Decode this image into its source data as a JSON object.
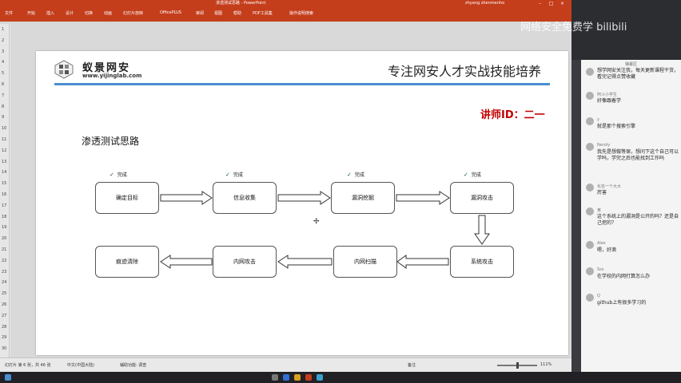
{
  "window": {
    "title": "渗透测试思路 - PowerPoint",
    "user": "zhyang zhenmenho"
  },
  "menu": [
    "文件",
    "开始",
    "插入",
    "设计",
    "切换",
    "动画",
    "幻灯片放映",
    "OfficePLUS",
    "审阅",
    "视图",
    "帮助",
    "PDF工具集",
    "操作说明搜索"
  ],
  "slide": {
    "brand": "蚁景网安",
    "brand_url": "www.yijinglab.com",
    "slogan": "专注网安人才实战技能培养",
    "lecturer": "讲师ID：二一",
    "section_title": "渗透测试思路",
    "done_label": "完成",
    "check_icon": "✓",
    "stages": [
      {
        "label": "确定目标",
        "done": true
      },
      {
        "label": "信息收集",
        "done": true
      },
      {
        "label": "漏洞挖掘",
        "done": true
      },
      {
        "label": "漏洞攻击",
        "done": true
      },
      {
        "label": "系统攻击",
        "done": false
      },
      {
        "label": "内网扫描",
        "done": false
      },
      {
        "label": "内网攻击",
        "done": false
      },
      {
        "label": "痕迹清除",
        "done": false
      }
    ]
  },
  "thumb_numbers": [
    "1",
    "2",
    "3",
    "4",
    "5",
    "6",
    "7",
    "8",
    "9",
    "10",
    "11",
    "12",
    "13",
    "14",
    "15",
    "16",
    "17",
    "18",
    "19",
    "20",
    "21",
    "22",
    "23",
    "24",
    "25",
    "26",
    "27",
    "28",
    "29",
    "30"
  ],
  "status": {
    "slide_info": "幻灯片 第 6 张，共 46 张",
    "language": "中文(中国大陆)",
    "accessibility": "辅助功能: 调查",
    "notes": "备注",
    "zoom": "111%"
  },
  "overlay": {
    "watermark": "网络安全免费学 bilibili"
  },
  "chat": {
    "header": "弹幕区",
    "messages": [
      {
        "user": "",
        "text": "想学网安关注我，每天更新课程干货，看完记得点赞收藏"
      },
      {
        "user": "阿斗小学生",
        "text": "好像跟着学"
      },
      {
        "user": "y",
        "text": "就是那个搜索引擎"
      },
      {
        "user": "Neroly",
        "text": "我先是想做等保，想问下这个自己可以学吗，学完之后也能找到工作吗"
      },
      {
        "user": "化名一个大大",
        "text": "厉害"
      },
      {
        "user": "某",
        "text": "这个系统上的漏洞是公开的吗？还是自己挖的？"
      },
      {
        "user": "Alex",
        "text": "嗯，好滴"
      },
      {
        "user": "Sss",
        "text": "在学校的内网打算怎么办"
      },
      {
        "user": "Q",
        "text": "github上有很多学习的"
      }
    ]
  },
  "colors": {
    "ppt_accent": "#c43e1c",
    "header_line": "#4a8fd0",
    "lecturer": "#c00000"
  }
}
